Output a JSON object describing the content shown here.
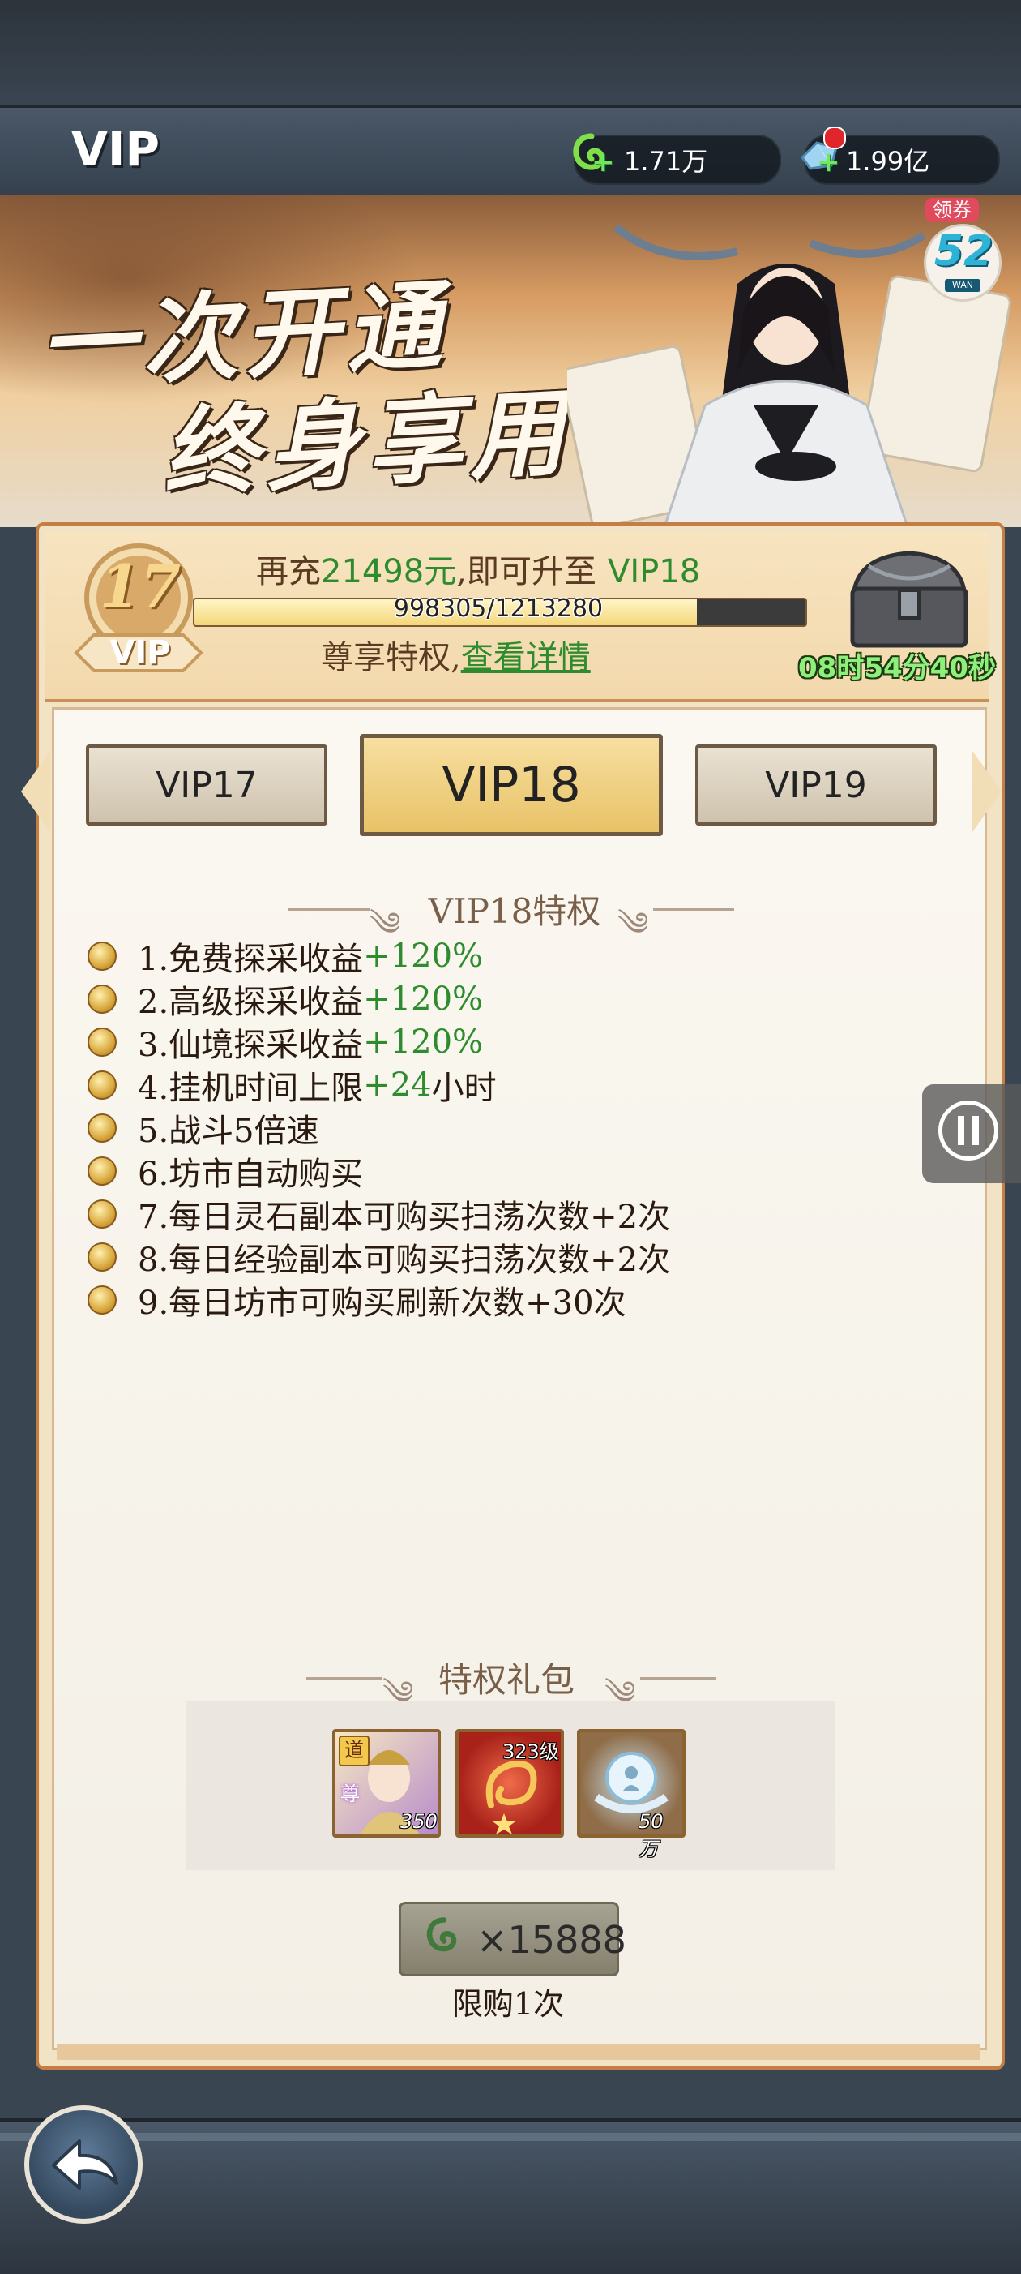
{
  "header": {
    "title": "VIP",
    "currency1": {
      "icon": "jade-spirit-icon",
      "value": "1.71万"
    },
    "currency2": {
      "icon": "spirit-stone-icon",
      "value": "1.99亿"
    }
  },
  "coupon": {
    "label": "领券",
    "number": "52",
    "sub": "WAN"
  },
  "banner": {
    "line1": "一次开通",
    "line2": "终身享用"
  },
  "status": {
    "vip_level": "17",
    "vip_label": "VIP",
    "recharge_prefix": "再充",
    "recharge_amount": "21498元",
    "recharge_middle": ",即可升至",
    "recharge_target": "VIP18",
    "progress_text": "998305/1213280",
    "progress_fraction": 0.8228,
    "privilege_prefix": "尊享特权,",
    "privilege_link": "查看详情",
    "countdown": "08时54分40秒"
  },
  "tabs": {
    "prev": "VIP17",
    "current": "VIP18",
    "next": "VIP19"
  },
  "privileges_title": "VIP18特权",
  "privileges": [
    {
      "text": "1.免费探采收益",
      "value": "+120%"
    },
    {
      "text": "2.高级探采收益",
      "value": "+120%"
    },
    {
      "text": "3.仙境探采收益",
      "value": "+120%"
    },
    {
      "text": "4.挂机时间上限",
      "value": "+24",
      "suffix": "小时"
    },
    {
      "text": "5.战斗5倍速"
    },
    {
      "text": "6.坊市自动购买"
    },
    {
      "text": "7.每日灵石副本可购买扫荡次数+2次"
    },
    {
      "text": "8.每日经验副本可购买扫荡次数+2次"
    },
    {
      "text": "9.每日坊市可购买刷新次数+30次"
    }
  ],
  "gift_title": "特权礼包",
  "gifts": [
    {
      "icon": "character-card-icon",
      "badge": "道",
      "tag": "尊",
      "count": "350"
    },
    {
      "icon": "dragon-artifact-icon",
      "level": "323级"
    },
    {
      "icon": "spirit-orb-icon",
      "count": "50万"
    }
  ],
  "purchase": {
    "price": "×15888",
    "limit": "限购1次"
  }
}
